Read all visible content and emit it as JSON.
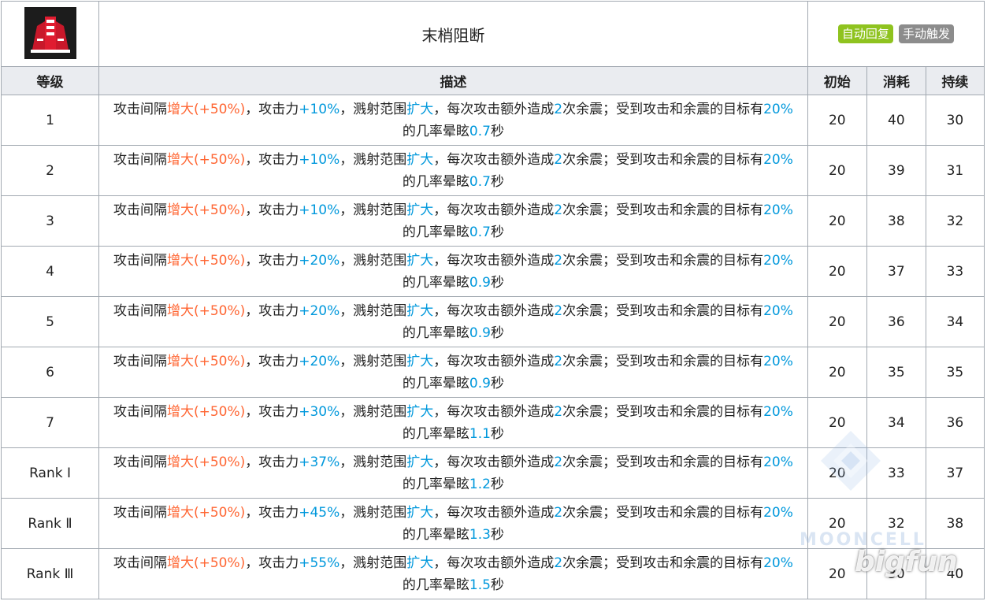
{
  "skill": {
    "icon": "red-cannon-turret-icon",
    "name": "末梢阻断",
    "tags": [
      "自动回复",
      "手动触发"
    ]
  },
  "headers": {
    "level": "等级",
    "desc": "描述",
    "init": "初始",
    "cost": "消耗",
    "duration": "持续"
  },
  "colors": {
    "increase": "#ff6633",
    "value": "#0098dc",
    "tag_auto": "#8fc31f",
    "tag_manual": "#8c8c8c",
    "header_bg": "#eaecf0"
  },
  "rows": [
    {
      "level": "1",
      "d": [
        "攻击间隔",
        "增大(+50%)",
        "，攻击力",
        "+10%",
        "，溅射范围",
        "扩大",
        "，每次攻击额外造成",
        "2",
        "次余震；受到攻击和余震的目标有",
        "20%",
        "的几率晕眩",
        "0.7",
        "秒"
      ],
      "init": "20",
      "cost": "40",
      "dur": "30"
    },
    {
      "level": "2",
      "d": [
        "攻击间隔",
        "增大(+50%)",
        "，攻击力",
        "+10%",
        "，溅射范围",
        "扩大",
        "，每次攻击额外造成",
        "2",
        "次余震；受到攻击和余震的目标有",
        "20%",
        "的几率晕眩",
        "0.7",
        "秒"
      ],
      "init": "20",
      "cost": "39",
      "dur": "31"
    },
    {
      "level": "3",
      "d": [
        "攻击间隔",
        "增大(+50%)",
        "，攻击力",
        "+10%",
        "，溅射范围",
        "扩大",
        "，每次攻击额外造成",
        "2",
        "次余震；受到攻击和余震的目标有",
        "20%",
        "的几率晕眩",
        "0.7",
        "秒"
      ],
      "init": "20",
      "cost": "38",
      "dur": "32"
    },
    {
      "level": "4",
      "d": [
        "攻击间隔",
        "增大(+50%)",
        "，攻击力",
        "+20%",
        "，溅射范围",
        "扩大",
        "，每次攻击额外造成",
        "2",
        "次余震；受到攻击和余震的目标有",
        "20%",
        "的几率晕眩",
        "0.9",
        "秒"
      ],
      "init": "20",
      "cost": "37",
      "dur": "33"
    },
    {
      "level": "5",
      "d": [
        "攻击间隔",
        "增大(+50%)",
        "，攻击力",
        "+20%",
        "，溅射范围",
        "扩大",
        "，每次攻击额外造成",
        "2",
        "次余震；受到攻击和余震的目标有",
        "20%",
        "的几率晕眩",
        "0.9",
        "秒"
      ],
      "init": "20",
      "cost": "36",
      "dur": "34"
    },
    {
      "level": "6",
      "d": [
        "攻击间隔",
        "增大(+50%)",
        "，攻击力",
        "+20%",
        "，溅射范围",
        "扩大",
        "，每次攻击额外造成",
        "2",
        "次余震；受到攻击和余震的目标有",
        "20%",
        "的几率晕眩",
        "0.9",
        "秒"
      ],
      "init": "20",
      "cost": "35",
      "dur": "35"
    },
    {
      "level": "7",
      "d": [
        "攻击间隔",
        "增大(+50%)",
        "，攻击力",
        "+30%",
        "，溅射范围",
        "扩大",
        "，每次攻击额外造成",
        "2",
        "次余震；受到攻击和余震的目标有",
        "20%",
        "的几率晕眩",
        "1.1",
        "秒"
      ],
      "init": "20",
      "cost": "34",
      "dur": "36"
    },
    {
      "level": "Rank Ⅰ",
      "d": [
        "攻击间隔",
        "增大(+50%)",
        "，攻击力",
        "+37%",
        "，溅射范围",
        "扩大",
        "，每次攻击额外造成",
        "2",
        "次余震；受到攻击和余震的目标有",
        "20%",
        "的几率晕眩",
        "1.2",
        "秒"
      ],
      "init": "20",
      "cost": "33",
      "dur": "37"
    },
    {
      "level": "Rank Ⅱ",
      "d": [
        "攻击间隔",
        "增大(+50%)",
        "，攻击力",
        "+45%",
        "，溅射范围",
        "扩大",
        "，每次攻击额外造成",
        "2",
        "次余震；受到攻击和余震的目标有",
        "20%",
        "的几率晕眩",
        "1.3",
        "秒"
      ],
      "init": "20",
      "cost": "32",
      "dur": "38"
    },
    {
      "level": "Rank Ⅲ",
      "d": [
        "攻击间隔",
        "增大(+50%)",
        "，攻击力",
        "+55%",
        "，溅射范围",
        "扩大",
        "，每次攻击额外造成",
        "2",
        "次余震；受到攻击和余震的目标有",
        "20%",
        "的几率晕眩",
        "1.5",
        "秒"
      ],
      "init": "20",
      "cost": "30",
      "dur": "40"
    }
  ],
  "watermarks": {
    "moon": "MOONCELL",
    "big": "bigfun"
  }
}
